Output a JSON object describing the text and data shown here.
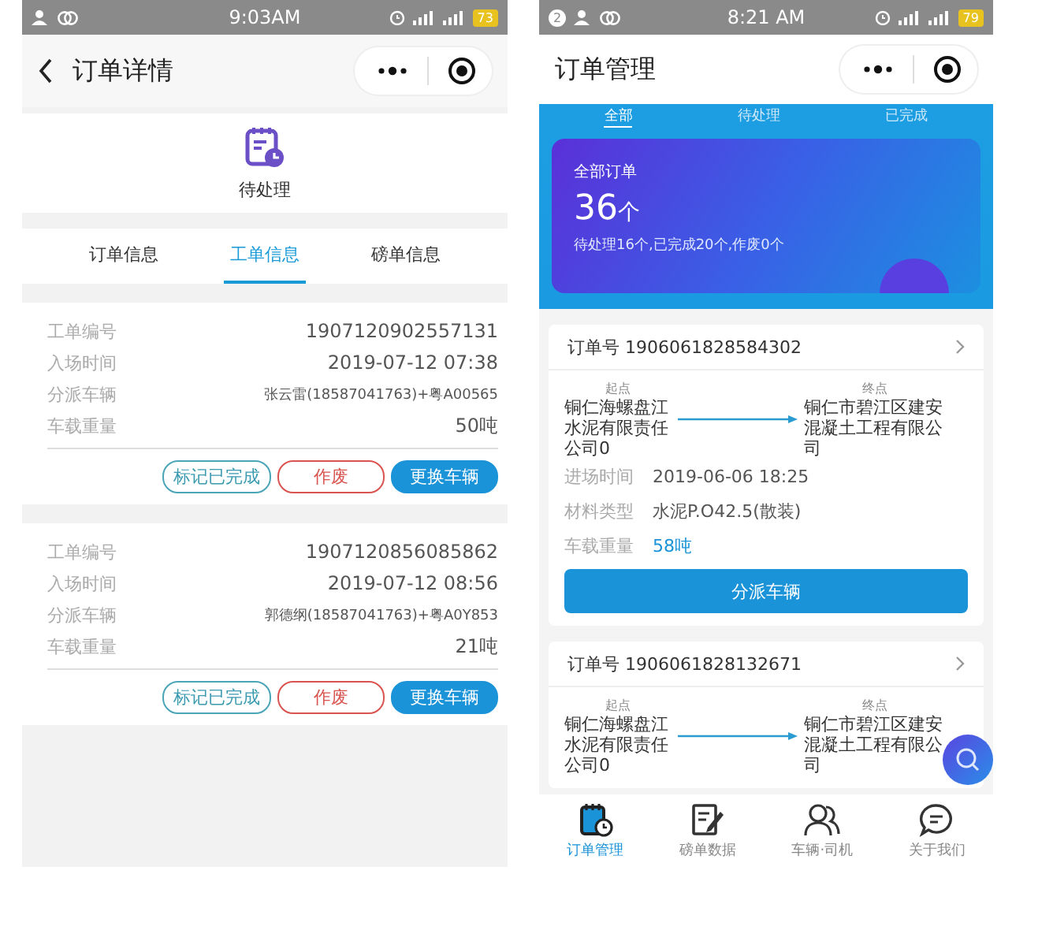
{
  "left_screen": {
    "status_bar": {
      "time": "9:03AM",
      "battery": "73"
    },
    "nav_bar": {
      "title": "订单详情"
    },
    "order_status": {
      "label": "待处理"
    },
    "tabs": [
      {
        "label": "订单信息",
        "selected": false
      },
      {
        "label": "工单信息",
        "selected": true
      },
      {
        "label": "磅单信息",
        "selected": false
      }
    ],
    "work_orders": [
      {
        "fields": [
          {
            "label": "工单编号",
            "value": "1907120902557131",
            "kind": "text"
          },
          {
            "label": "入场时间",
            "value": "2019-07-12 07:38",
            "kind": "text"
          },
          {
            "label": "分派车辆",
            "value": "张云雷(18587041763)+粤A00565",
            "kind": "vehicle"
          },
          {
            "label": "车载重量",
            "value": "50吨",
            "kind": "text"
          }
        ],
        "actions": [
          {
            "label": "标记已完成",
            "kind": "outline"
          },
          {
            "label": "作废",
            "kind": "danger"
          },
          {
            "label": "更换车辆",
            "kind": "primary"
          }
        ]
      },
      {
        "fields": [
          {
            "label": "工单编号",
            "value": "1907120856085862",
            "kind": "text"
          },
          {
            "label": "入场时间",
            "value": "2019-07-12 08:56",
            "kind": "text"
          },
          {
            "label": "分派车辆",
            "value": "郭德纲(18587041763)+粤A0Y853",
            "kind": "vehicle"
          },
          {
            "label": "车载重量",
            "value": "21吨",
            "kind": "text"
          }
        ],
        "actions": [
          {
            "label": "标记已完成",
            "kind": "outline"
          },
          {
            "label": "作废",
            "kind": "danger"
          },
          {
            "label": "更换车辆",
            "kind": "primary"
          }
        ]
      }
    ]
  },
  "right_screen": {
    "status_bar": {
      "notification_count": "2",
      "time": "8:21 AM",
      "battery": "79"
    },
    "nav_bar": {
      "title": "订单管理"
    },
    "tabs": [
      {
        "label": "全部",
        "selected": true
      },
      {
        "label": "待处理",
        "selected": false
      },
      {
        "label": "已完成",
        "selected": false
      }
    ],
    "summary": {
      "title": "全部订单",
      "count": "36",
      "unit": "个",
      "breakdown": "待处理16个,已完成20个,作废0个"
    },
    "orders": [
      {
        "number": "订单号 1906061828584302",
        "origin_label": "起点",
        "origin": "铜仁海螺盘江水泥有限责任公司0",
        "destination_label": "终点",
        "destination": "铜仁市碧江区建安混凝土工程有限公司",
        "details": [
          {
            "label": "进场时间",
            "value": "2019-06-06 18:25",
            "kind": "plain"
          },
          {
            "label": "材料类型",
            "value": "水泥P.O42.5(散装)",
            "kind": "plain"
          },
          {
            "label": "车载重量",
            "value": "58吨",
            "kind": "highlight"
          }
        ],
        "button": "分派车辆"
      },
      {
        "number": "订单号 1906061828132671",
        "origin_label": "起点",
        "origin": "铜仁海螺盘江水泥有限责任公司0",
        "destination_label": "终点",
        "destination": "铜仁市碧江区建安混凝土工程有限公司"
      }
    ],
    "tab_bar": [
      {
        "label": "订单管理",
        "kind": "orders",
        "selected": true
      },
      {
        "label": "磅单数据",
        "kind": "weigh",
        "selected": false
      },
      {
        "label": "车辆·司机",
        "kind": "drivers",
        "selected": false
      },
      {
        "label": "关于我们",
        "kind": "about",
        "selected": false
      }
    ]
  }
}
